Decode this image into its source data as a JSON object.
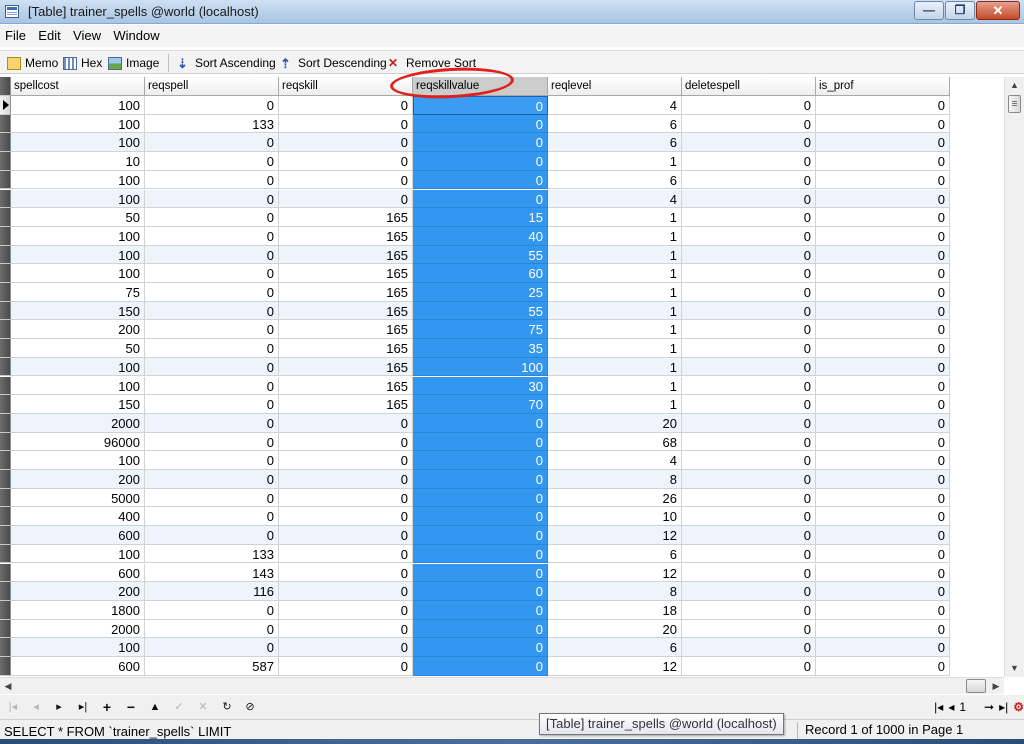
{
  "window": {
    "title": "[Table] trainer_spells @world (localhost)",
    "buttons": {
      "minimize": "—",
      "maximize": "❐",
      "close": "✕"
    }
  },
  "menu": [
    "File",
    "Edit",
    "View",
    "Window"
  ],
  "toolbar": {
    "memo": "Memo",
    "hex": "Hex",
    "image": "Image",
    "sort_ascending": "Sort Ascending",
    "sort_descending": "Sort Descending",
    "remove_sort": "Remove Sort"
  },
  "grid": {
    "columns": [
      "spellcost",
      "reqspell",
      "reqskill",
      "reqskillvalue",
      "reqlevel",
      "deletespell",
      "is_prof"
    ],
    "selected_column": "reqskillvalue",
    "rows": [
      [
        "100",
        "0",
        "0",
        "0",
        "4",
        "0",
        "0"
      ],
      [
        "100",
        "133",
        "0",
        "0",
        "6",
        "0",
        "0"
      ],
      [
        "100",
        "0",
        "0",
        "0",
        "6",
        "0",
        "0"
      ],
      [
        "10",
        "0",
        "0",
        "0",
        "1",
        "0",
        "0"
      ],
      [
        "100",
        "0",
        "0",
        "0",
        "6",
        "0",
        "0"
      ],
      [
        "100",
        "0",
        "0",
        "0",
        "4",
        "0",
        "0"
      ],
      [
        "50",
        "0",
        "165",
        "15",
        "1",
        "0",
        "0"
      ],
      [
        "100",
        "0",
        "165",
        "40",
        "1",
        "0",
        "0"
      ],
      [
        "100",
        "0",
        "165",
        "55",
        "1",
        "0",
        "0"
      ],
      [
        "100",
        "0",
        "165",
        "60",
        "1",
        "0",
        "0"
      ],
      [
        "75",
        "0",
        "165",
        "25",
        "1",
        "0",
        "0"
      ],
      [
        "150",
        "0",
        "165",
        "55",
        "1",
        "0",
        "0"
      ],
      [
        "200",
        "0",
        "165",
        "75",
        "1",
        "0",
        "0"
      ],
      [
        "50",
        "0",
        "165",
        "35",
        "1",
        "0",
        "0"
      ],
      [
        "100",
        "0",
        "165",
        "100",
        "1",
        "0",
        "0"
      ],
      [
        "100",
        "0",
        "165",
        "30",
        "1",
        "0",
        "0"
      ],
      [
        "150",
        "0",
        "165",
        "70",
        "1",
        "0",
        "0"
      ],
      [
        "2000",
        "0",
        "0",
        "0",
        "20",
        "0",
        "0"
      ],
      [
        "96000",
        "0",
        "0",
        "0",
        "68",
        "0",
        "0"
      ],
      [
        "100",
        "0",
        "0",
        "0",
        "4",
        "0",
        "0"
      ],
      [
        "200",
        "0",
        "0",
        "0",
        "8",
        "0",
        "0"
      ],
      [
        "5000",
        "0",
        "0",
        "0",
        "26",
        "0",
        "0"
      ],
      [
        "400",
        "0",
        "0",
        "0",
        "10",
        "0",
        "0"
      ],
      [
        "600",
        "0",
        "0",
        "0",
        "12",
        "0",
        "0"
      ],
      [
        "100",
        "133",
        "0",
        "0",
        "6",
        "0",
        "0"
      ],
      [
        "600",
        "143",
        "0",
        "0",
        "12",
        "0",
        "0"
      ],
      [
        "200",
        "116",
        "0",
        "0",
        "8",
        "0",
        "0"
      ],
      [
        "1800",
        "0",
        "0",
        "0",
        "18",
        "0",
        "0"
      ],
      [
        "2000",
        "0",
        "0",
        "0",
        "20",
        "0",
        "0"
      ],
      [
        "100",
        "0",
        "0",
        "0",
        "6",
        "0",
        "0"
      ],
      [
        "600",
        "587",
        "0",
        "0",
        "12",
        "0",
        "0"
      ]
    ]
  },
  "navigator": {
    "page_number": "1"
  },
  "status": {
    "sql": "SELECT * FROM `trainer_spells` LIMIT",
    "tooltip": "[Table] trainer_spells @world (localhost)",
    "record": "Record 1 of 1000 in Page 1"
  },
  "colors": {
    "highlight": "#3397f0",
    "annotation": "#e0201a"
  }
}
